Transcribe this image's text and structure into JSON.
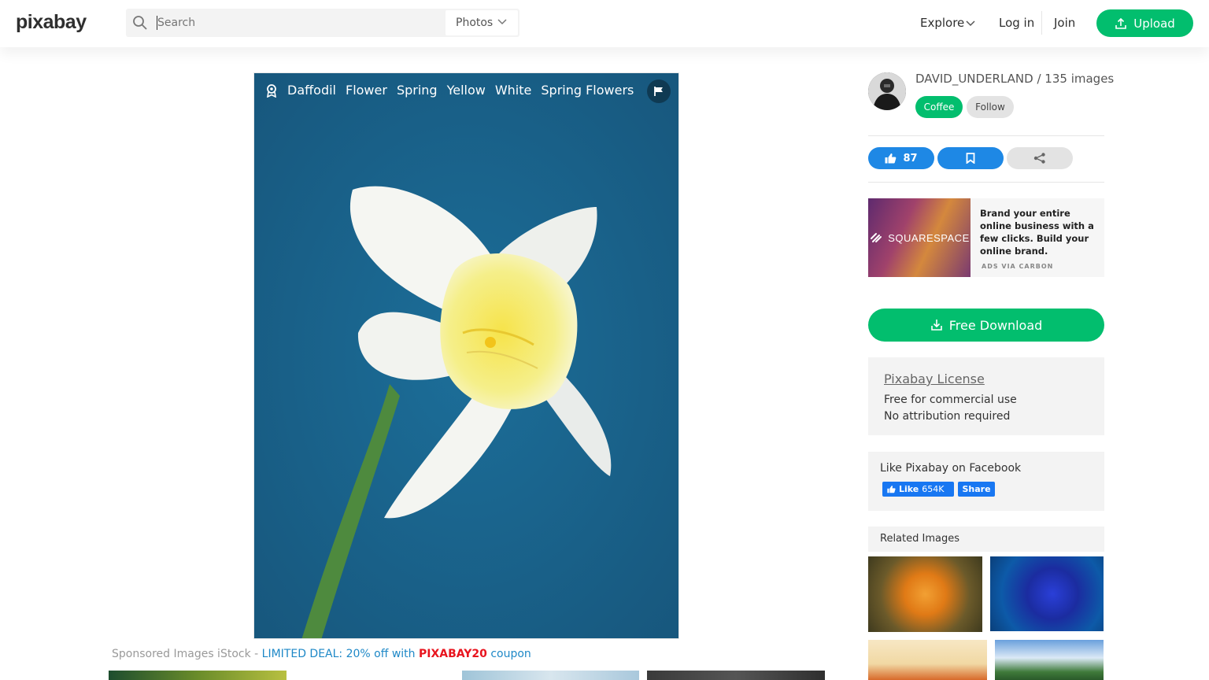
{
  "header": {
    "logo": "pixabay",
    "search_placeholder": "Search",
    "search_type": "Photos",
    "explore": "Explore",
    "login": "Log in",
    "join": "Join",
    "upload": "Upload"
  },
  "photo": {
    "tags": [
      "Daffodil",
      "Flower",
      "Spring",
      "Yellow",
      "White",
      "Spring Flowers"
    ]
  },
  "sponsored": {
    "prefix": "Sponsored Images iStock - ",
    "deal": "LIMITED DEAL: 20% off with ",
    "code": "PIXABAY20",
    "suffix": " coupon"
  },
  "author": {
    "name_line": "DAVID_UNDERLAND / 135 images",
    "coffee": "Coffee",
    "follow": "Follow"
  },
  "actions": {
    "likes": "87"
  },
  "ad": {
    "brand": "SQUARESPACE",
    "text": "Brand your entire online business with a few clicks. Build your online brand.",
    "via": "ADS VIA CARBON"
  },
  "download": {
    "label": "Free Download"
  },
  "license": {
    "title": "Pixabay License",
    "line1": "Free for commercial use",
    "line2": "No attribution required"
  },
  "facebook": {
    "title": "Like Pixabay on Facebook",
    "like": "Like",
    "like_count": "654K",
    "share": "Share"
  },
  "related": {
    "title": "Related Images"
  },
  "colors": {
    "brand_green": "#02be6e",
    "action_blue": "#1e88e5",
    "photo_bg": "#1f6b95"
  }
}
